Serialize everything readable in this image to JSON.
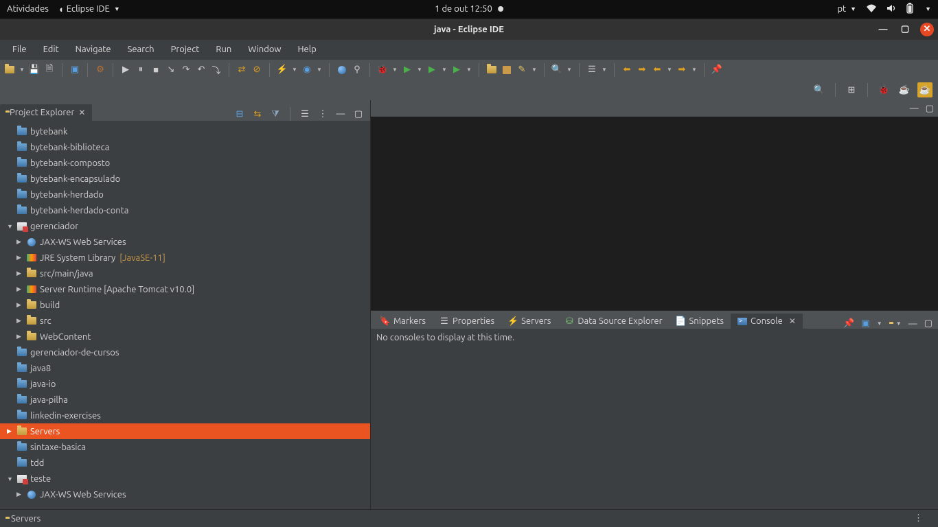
{
  "gnome": {
    "activities": "Atividades",
    "app": "Eclipse IDE",
    "datetime": "1 de out  12:50",
    "lang": "pt"
  },
  "window": {
    "title": "java - Eclipse IDE"
  },
  "menu": {
    "file": "File",
    "edit": "Edit",
    "navigate": "Navigate",
    "search": "Search",
    "project": "Project",
    "run": "Run",
    "window": "Window",
    "help": "Help"
  },
  "project_explorer": {
    "tab_label": "Project Explorer",
    "items": [
      {
        "label": "bytebank",
        "type": "project-closed"
      },
      {
        "label": "bytebank-biblioteca",
        "type": "project-closed"
      },
      {
        "label": "bytebank-composto",
        "type": "project-closed"
      },
      {
        "label": "bytebank-encapsulado",
        "type": "project-closed"
      },
      {
        "label": "bytebank-herdado",
        "type": "project-closed"
      },
      {
        "label": "bytebank-herdado-conta",
        "type": "project-closed"
      },
      {
        "label": "gerenciador",
        "type": "webproj",
        "twisty": "open",
        "children": [
          {
            "label": "JAX-WS Web Services",
            "type": "globe",
            "twisty": "closed"
          },
          {
            "label": "JRE System Library",
            "suffix": "[JavaSE-11]",
            "type": "lib",
            "twisty": "closed"
          },
          {
            "label": "src/main/java",
            "type": "folder-open",
            "twisty": "closed"
          },
          {
            "label": "Server Runtime [Apache Tomcat v10.0]",
            "type": "lib",
            "twisty": "closed"
          },
          {
            "label": "build",
            "type": "folder-open",
            "twisty": "closed"
          },
          {
            "label": "src",
            "type": "folder-open",
            "twisty": "closed"
          },
          {
            "label": "WebContent",
            "type": "folder-open",
            "twisty": "closed"
          }
        ]
      },
      {
        "label": "gerenciador-de-cursos",
        "type": "project-closed"
      },
      {
        "label": "java8",
        "type": "project-closed"
      },
      {
        "label": "java-io",
        "type": "project-closed"
      },
      {
        "label": "java-pilha",
        "type": "project-closed"
      },
      {
        "label": "linkedin-exercises",
        "type": "project-closed"
      },
      {
        "label": "Servers",
        "type": "folder-open",
        "twisty": "closed",
        "selected": true
      },
      {
        "label": "sintaxe-basica",
        "type": "project-closed"
      },
      {
        "label": "tdd",
        "type": "project-closed"
      },
      {
        "label": "teste",
        "type": "webproj",
        "twisty": "open",
        "children": [
          {
            "label": "JAX-WS Web Services",
            "type": "globe",
            "twisty": "closed"
          }
        ]
      }
    ]
  },
  "bottom_tabs": {
    "markers": "Markers",
    "properties": "Properties",
    "servers": "Servers",
    "data_source": "Data Source Explorer",
    "snippets": "Snippets",
    "console": "Console"
  },
  "console_message": "No consoles to display at this time.",
  "status": {
    "servers": "Servers"
  }
}
